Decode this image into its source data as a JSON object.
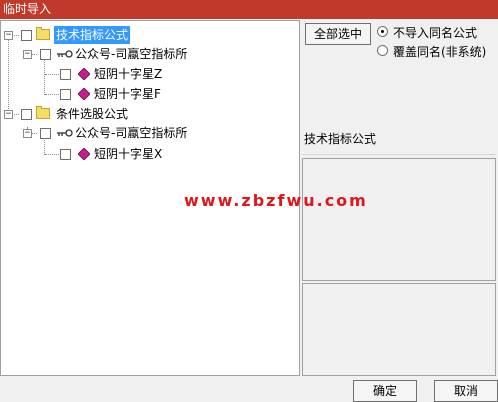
{
  "window": {
    "title": "临时导入"
  },
  "tree": {
    "nodes": [
      {
        "label": "技术指标公式",
        "selected": true,
        "icon": "folder-icon"
      },
      {
        "label": "公众号-司蠃空指标所",
        "icon": "link-icon"
      },
      {
        "label": "短阴十字星Z",
        "icon": "diamond-icon"
      },
      {
        "label": "短阴十字星F",
        "icon": "diamond-icon"
      },
      {
        "label": "条件选股公式",
        "icon": "folder-icon"
      },
      {
        "label": "公众号-司蠃空指标所",
        "icon": "link-icon"
      },
      {
        "label": "短阴十字星X",
        "icon": "diamond-icon"
      }
    ]
  },
  "options": {
    "select_all_label": "全部选中",
    "radio_no_import": "不导入同名公式",
    "radio_overwrite": "覆盖同名(非系统)",
    "selected_radio": "no_import"
  },
  "info": {
    "label": "技术指标公式"
  },
  "watermark": "www.zbzfwu.com",
  "footer": {
    "ok_label": "确定",
    "cancel_label": "取消"
  },
  "colors": {
    "titlebar": "#c0392b",
    "selection": "#3399ff",
    "folder": "#f4dc6a",
    "diamond": "#c0208a",
    "watermark": "#e0161b"
  }
}
